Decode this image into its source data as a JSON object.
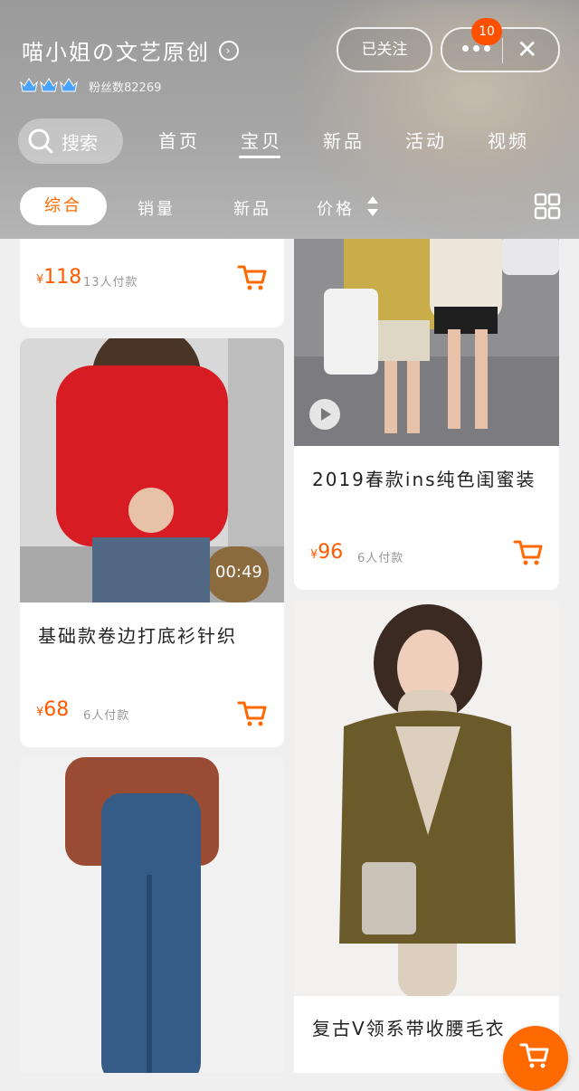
{
  "header": {
    "shop_name": "喵小姐の文艺原创",
    "fans_label": "粉丝数82269",
    "follow_label": "已关注",
    "badge_count": "10",
    "close_symbol": "✕",
    "arrow_symbol": "›"
  },
  "nav": {
    "search_label": "搜索",
    "tabs": [
      "首页",
      "宝贝",
      "新品",
      "活动",
      "视频"
    ],
    "active_tab": "宝贝"
  },
  "sort": {
    "items": [
      "综合",
      "销量",
      "新品",
      "价格"
    ],
    "active": "综合",
    "price_arrows": "▲▼"
  },
  "products": [
    {
      "price": "118",
      "paid": "13人付款",
      "title": ""
    },
    {
      "price": "96",
      "paid": "6人付款",
      "title": "2019春款ins纯色闺蜜装"
    },
    {
      "price": "68",
      "paid": "6人付款",
      "title": "基础款卷边打底衫针织",
      "duration": "00:49"
    },
    {
      "price": "",
      "paid": "",
      "title": ""
    },
    {
      "price": "",
      "paid": "",
      "title": "复古V领系带收腰毛衣"
    }
  ],
  "currency": "¥",
  "colors": {
    "accent": "#ff6a00",
    "price": "#ff5a00"
  }
}
